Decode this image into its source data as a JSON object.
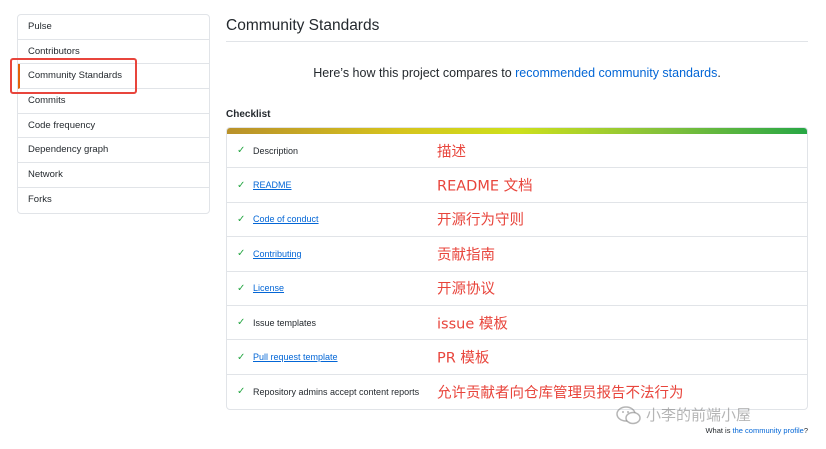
{
  "sidebar": {
    "items": [
      {
        "label": "Pulse"
      },
      {
        "label": "Contributors"
      },
      {
        "label": "Community Standards"
      },
      {
        "label": "Commits"
      },
      {
        "label": "Code frequency"
      },
      {
        "label": "Dependency graph"
      },
      {
        "label": "Network"
      },
      {
        "label": "Forks"
      }
    ]
  },
  "main": {
    "title": "Community Standards",
    "intro_text": "Here’s how this project compares to ",
    "intro_link": "recommended community standards",
    "intro_end": ".",
    "checklist_heading": "Checklist",
    "checklist": [
      {
        "label": "Description",
        "annotation": "描述"
      },
      {
        "label": "README",
        "annotation": "README 文档"
      },
      {
        "label": "Code of conduct",
        "annotation": "开源行为守则"
      },
      {
        "label": "Contributing",
        "annotation": "贡献指南"
      },
      {
        "label": "License",
        "annotation": "开源协议"
      },
      {
        "label": "Issue templates",
        "annotation": "issue 模板"
      },
      {
        "label": "Pull request template",
        "annotation": "PR 模板"
      },
      {
        "label": "Repository admins accept content reports",
        "annotation": "允许贡献者向仓库管理员报告不法行为"
      }
    ]
  },
  "footer": {
    "text": "What is ",
    "link": "the community profile",
    "end": "?"
  },
  "watermark": "小李的前端小屋",
  "colors": {
    "link": "#0366d6",
    "check": "#28a745",
    "annotation": "#e8453c",
    "selected_border": "#e36209"
  }
}
